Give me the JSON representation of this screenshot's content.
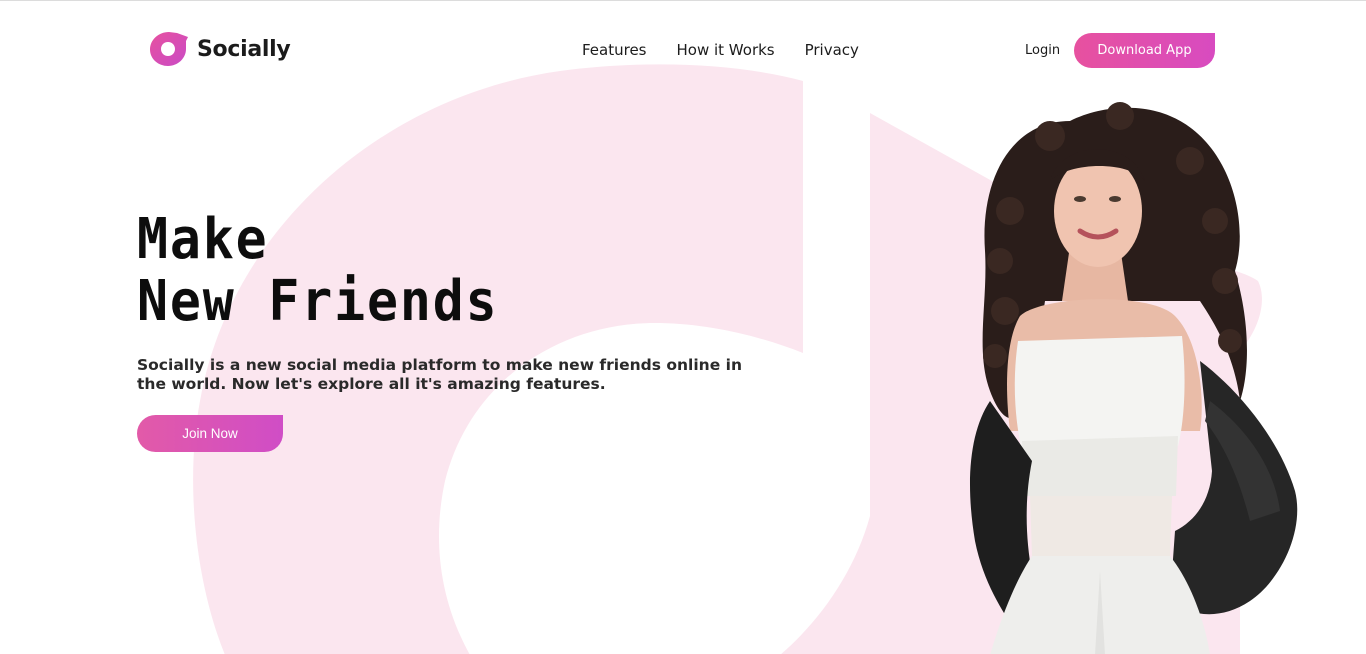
{
  "brand": {
    "name": "Socially",
    "logo_icon": "socially-logo-icon",
    "accent": "#d94bb5"
  },
  "nav": {
    "items": [
      {
        "label": "Features"
      },
      {
        "label": "How it Works"
      },
      {
        "label": "Privacy"
      }
    ]
  },
  "header": {
    "login_label": "Login",
    "download_label": "Download App"
  },
  "hero": {
    "title_line1": "Make",
    "title_line2": "New Friends",
    "description": "Socially is a new social media platform to make new friends online in the world. Now let's explore all it's amazing features.",
    "cta_label": "Join Now"
  },
  "colors": {
    "background_shape": "#fbe6ef",
    "button_gradient_start": "#e7519f",
    "button_gradient_end": "#d84bc0",
    "text": "#111111"
  }
}
